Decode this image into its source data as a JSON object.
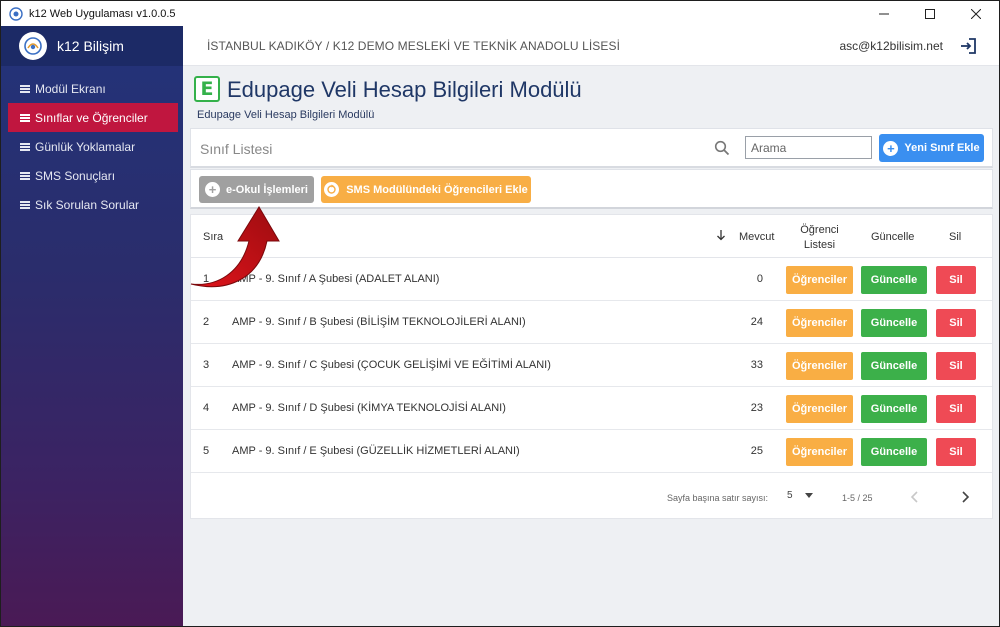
{
  "window": {
    "title": "k12 Web Uygulaması v1.0.0.5"
  },
  "sidebar": {
    "brand": "k12 Bilişim",
    "items": [
      {
        "label": "Modül Ekranı"
      },
      {
        "label": "Sınıflar ve Öğrenciler",
        "active": true
      },
      {
        "label": "Günlük Yoklamalar"
      },
      {
        "label": "SMS Sonuçları"
      },
      {
        "label": "Sık Sorulan Sorular"
      }
    ]
  },
  "header": {
    "school": "İSTANBUL KADIKÖY / K12 DEMO MESLEKİ VE TEKNİK ANADOLU LİSESİ",
    "email": "asc@k12bilisim.net"
  },
  "page": {
    "logo_letter": "E",
    "title": "Edupage Veli Hesap Bilgileri Modülü",
    "subtitle": "Edupage Veli Hesap Bilgileri Modülü"
  },
  "toolbar": {
    "card_title": "Sınıf Listesi",
    "search_placeholder": "Arama",
    "new_class_label": "Yeni Sınıf Ekle"
  },
  "actions": {
    "eokul_label": "e-Okul İşlemleri",
    "sms_label": "SMS Modülündeki Öğrencileri Ekle"
  },
  "table": {
    "headers": {
      "sira": "Sıra",
      "mevcut": "Mevcut",
      "ogrenci_listesi": "Öğrenci Listesi",
      "guncelle": "Güncelle",
      "sil": "Sil"
    },
    "rows": [
      {
        "no": "1",
        "name": "AMP -  9. Sınıf / A Şubesi (ADALET ALANI)",
        "count": "0"
      },
      {
        "no": "2",
        "name": "AMP -  9. Sınıf / B Şubesi (BİLİŞİM TEKNOLOJİLERİ ALANI)",
        "count": "24"
      },
      {
        "no": "3",
        "name": "AMP -  9. Sınıf / C Şubesi (ÇOCUK GELİŞİMİ VE EĞİTİMİ ALANI)",
        "count": "33"
      },
      {
        "no": "4",
        "name": "AMP -  9. Sınıf / D Şubesi (KİMYA TEKNOLOJİSİ ALANI)",
        "count": "23"
      },
      {
        "no": "5",
        "name": "AMP -  9. Sınıf / E Şubesi (GÜZELLİK HİZMETLERİ ALANI)",
        "count": "25"
      }
    ],
    "btn_students": "Öğrenciler",
    "btn_update": "Güncelle",
    "btn_delete": "Sil"
  },
  "pagination": {
    "rows_per_page_label": "Sayfa başına satır sayısı:",
    "rows_per_page": "5",
    "range": "1-5 / 25"
  },
  "colors": {
    "accent_active": "#c0163f",
    "primary": "#3a8ff0",
    "orange": "#f9ae44",
    "green": "#3cb04a",
    "red": "#ef4a55",
    "sidebar_top": "#23337a",
    "sidebar_bottom": "#4a1a55"
  }
}
